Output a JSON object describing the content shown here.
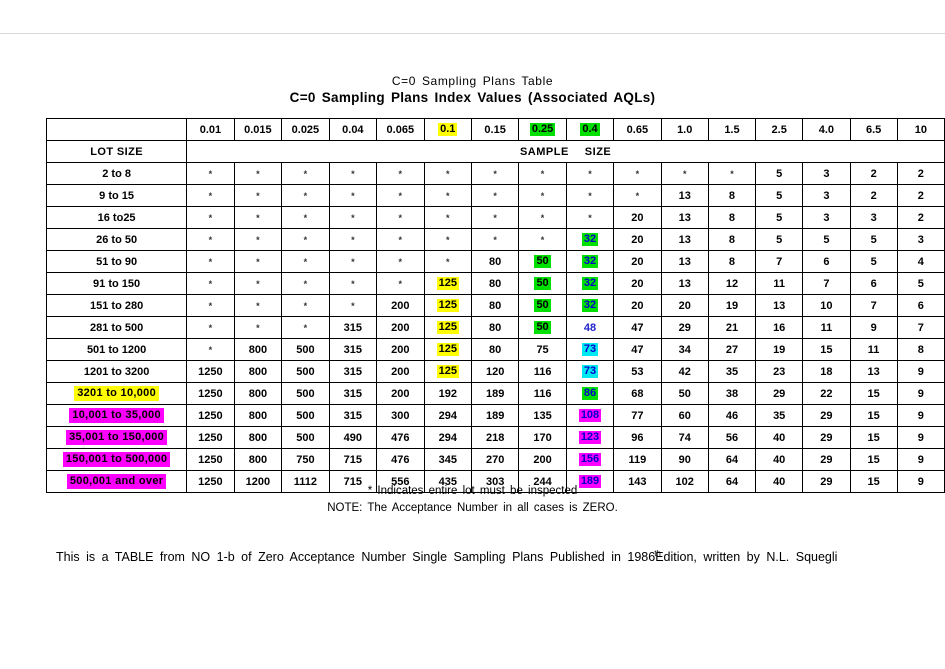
{
  "title": {
    "line1": "C=0  Sampling  Plans  Table",
    "line2": "C=0  Sampling  Plans  Index  Values  (Associated  AQLs)"
  },
  "table": {
    "lot_size_header": "LOT SIZE",
    "sample_size_banner_left": "SAMPLE",
    "sample_size_banner_right": "SIZE",
    "columns": [
      "0.01",
      "0.015",
      "0.025",
      "0.04",
      "0.065",
      "0.1",
      "0.15",
      "0.25",
      "0.4",
      "0.65",
      "1.0",
      "1.5",
      "2.5",
      "4.0",
      "6.5",
      "10"
    ],
    "column_highlights": [
      "none",
      "none",
      "none",
      "none",
      "none",
      "yellow",
      "none",
      "green",
      "green",
      "none",
      "none",
      "none",
      "none",
      "none",
      "none",
      "none"
    ],
    "asterisk_glyph": "*",
    "rows": [
      {
        "lot": "2 to 8",
        "lot_highlight": "none",
        "values": [
          "*",
          "*",
          "*",
          "*",
          "*",
          "*",
          "*",
          "*",
          "*",
          "*",
          "*",
          "*",
          "5",
          "3",
          "2",
          "2"
        ],
        "highlights": [
          "none",
          "none",
          "none",
          "none",
          "none",
          "none",
          "none",
          "none",
          "none",
          "none",
          "none",
          "none",
          "none",
          "none",
          "none",
          "none"
        ]
      },
      {
        "lot": "9 to 15",
        "lot_highlight": "none",
        "values": [
          "*",
          "*",
          "*",
          "*",
          "*",
          "*",
          "*",
          "*",
          "*",
          "*",
          "13",
          "8",
          "5",
          "3",
          "2",
          "2"
        ],
        "highlights": [
          "none",
          "none",
          "none",
          "none",
          "none",
          "none",
          "none",
          "none",
          "none",
          "none",
          "none",
          "none",
          "none",
          "none",
          "none",
          "none"
        ]
      },
      {
        "lot": "16 to25",
        "lot_highlight": "none",
        "values": [
          "*",
          "*",
          "*",
          "*",
          "*",
          "*",
          "*",
          "*",
          "*",
          "20",
          "13",
          "8",
          "5",
          "3",
          "3",
          "2"
        ],
        "highlights": [
          "none",
          "none",
          "none",
          "none",
          "none",
          "none",
          "none",
          "none",
          "none",
          "none",
          "none",
          "none",
          "none",
          "none",
          "none",
          "none"
        ]
      },
      {
        "lot": "26 to 50",
        "lot_highlight": "none",
        "values": [
          "*",
          "*",
          "*",
          "*",
          "*",
          "*",
          "*",
          "*",
          "32",
          "20",
          "13",
          "8",
          "5",
          "5",
          "5",
          "3"
        ],
        "highlights": [
          "none",
          "none",
          "none",
          "none",
          "none",
          "none",
          "none",
          "none",
          "green",
          "none",
          "none",
          "none",
          "none",
          "none",
          "none",
          "none"
        ]
      },
      {
        "lot": "51 to 90",
        "lot_highlight": "none",
        "values": [
          "*",
          "*",
          "*",
          "*",
          "*",
          "*",
          "80",
          "50",
          "32",
          "20",
          "13",
          "8",
          "7",
          "6",
          "5",
          "4"
        ],
        "highlights": [
          "none",
          "none",
          "none",
          "none",
          "none",
          "none",
          "none",
          "green-k",
          "green",
          "none",
          "none",
          "none",
          "none",
          "none",
          "none",
          "none"
        ]
      },
      {
        "lot": "91 to 150",
        "lot_highlight": "none",
        "values": [
          "*",
          "*",
          "*",
          "*",
          "*",
          "125",
          "80",
          "50",
          "32",
          "20",
          "13",
          "12",
          "11",
          "7",
          "6",
          "5"
        ],
        "highlights": [
          "none",
          "none",
          "none",
          "none",
          "none",
          "yellow",
          "none",
          "green-k",
          "green",
          "none",
          "none",
          "none",
          "none",
          "none",
          "none",
          "none"
        ]
      },
      {
        "lot": "151 to 280",
        "lot_highlight": "none",
        "values": [
          "*",
          "*",
          "*",
          "*",
          "200",
          "125",
          "80",
          "50",
          "32",
          "20",
          "20",
          "19",
          "13",
          "10",
          "7",
          "6"
        ],
        "highlights": [
          "none",
          "none",
          "none",
          "none",
          "none",
          "yellow",
          "none",
          "green-k",
          "green",
          "none",
          "none",
          "none",
          "none",
          "none",
          "none",
          "none"
        ]
      },
      {
        "lot": "281 to 500",
        "lot_highlight": "none",
        "values": [
          "*",
          "*",
          "*",
          "315",
          "200",
          "125",
          "80",
          "50",
          "48",
          "47",
          "29",
          "21",
          "16",
          "11",
          "9",
          "7"
        ],
        "highlights": [
          "none",
          "none",
          "none",
          "none",
          "none",
          "yellow",
          "none",
          "green-k",
          "blue",
          "none",
          "none",
          "none",
          "none",
          "none",
          "none",
          "none"
        ]
      },
      {
        "lot": "501 to 1200",
        "lot_highlight": "none",
        "values": [
          "*",
          "800",
          "500",
          "315",
          "200",
          "125",
          "80",
          "75",
          "73",
          "47",
          "34",
          "27",
          "19",
          "15",
          "11",
          "8"
        ],
        "highlights": [
          "none",
          "none",
          "none",
          "none",
          "none",
          "yellow",
          "none",
          "none",
          "cyan",
          "none",
          "none",
          "none",
          "none",
          "none",
          "none",
          "none"
        ]
      },
      {
        "lot": "1201 to 3200",
        "lot_highlight": "none",
        "values": [
          "1250",
          "800",
          "500",
          "315",
          "200",
          "125",
          "120",
          "116",
          "73",
          "53",
          "42",
          "35",
          "23",
          "18",
          "13",
          "9"
        ],
        "highlights": [
          "none",
          "none",
          "none",
          "none",
          "none",
          "yellow",
          "none",
          "none",
          "cyan",
          "none",
          "none",
          "none",
          "none",
          "none",
          "none",
          "none"
        ]
      },
      {
        "lot": "3201 to 10,000",
        "lot_highlight": "yellow",
        "values": [
          "1250",
          "800",
          "500",
          "315",
          "200",
          "192",
          "189",
          "116",
          "86",
          "68",
          "50",
          "38",
          "29",
          "22",
          "15",
          "9"
        ],
        "highlights": [
          "none",
          "none",
          "none",
          "none",
          "none",
          "none",
          "none",
          "none",
          "green",
          "none",
          "none",
          "none",
          "none",
          "none",
          "none",
          "none"
        ]
      },
      {
        "lot": "10,001 to 35,000",
        "lot_highlight": "magenta",
        "values": [
          "1250",
          "800",
          "500",
          "315",
          "300",
          "294",
          "189",
          "135",
          "108",
          "77",
          "60",
          "46",
          "35",
          "29",
          "15",
          "9"
        ],
        "highlights": [
          "none",
          "none",
          "none",
          "none",
          "none",
          "none",
          "none",
          "none",
          "magenta",
          "none",
          "none",
          "none",
          "none",
          "none",
          "none",
          "none"
        ]
      },
      {
        "lot": "35,001 to 150,000",
        "lot_highlight": "magenta",
        "values": [
          "1250",
          "800",
          "500",
          "490",
          "476",
          "294",
          "218",
          "170",
          "123",
          "96",
          "74",
          "56",
          "40",
          "29",
          "15",
          "9"
        ],
        "highlights": [
          "none",
          "none",
          "none",
          "none",
          "none",
          "none",
          "none",
          "none",
          "magenta",
          "none",
          "none",
          "none",
          "none",
          "none",
          "none",
          "none"
        ]
      },
      {
        "lot": "150,001 to 500,000",
        "lot_highlight": "magenta",
        "values": [
          "1250",
          "800",
          "750",
          "715",
          "476",
          "345",
          "270",
          "200",
          "156",
          "119",
          "90",
          "64",
          "40",
          "29",
          "15",
          "9"
        ],
        "highlights": [
          "none",
          "none",
          "none",
          "none",
          "none",
          "none",
          "none",
          "none",
          "magenta",
          "none",
          "none",
          "none",
          "none",
          "none",
          "none",
          "none"
        ]
      },
      {
        "lot": "500,001 and over",
        "lot_highlight": "magenta",
        "values": [
          "1250",
          "1200",
          "1112",
          "715",
          "556",
          "435",
          "303",
          "244",
          "189",
          "143",
          "102",
          "64",
          "40",
          "29",
          "15",
          "9"
        ],
        "highlights": [
          "none",
          "none",
          "none",
          "none",
          "none",
          "none",
          "none",
          "none",
          "magenta",
          "none",
          "none",
          "none",
          "none",
          "none",
          "none",
          "none"
        ]
      }
    ]
  },
  "notes": {
    "line1": "* Indicates entire lot must be inspected",
    "line2": "NOTE: The Acceptance Number in all cases is ZERO."
  },
  "footer": {
    "part1": "This is a TABLE from NO 1-b of Zero Acceptance Number Single Sampling Plans Published in 1986",
    "superscript": "th",
    "part2": "Edition, written by N.L. Squegli"
  },
  "colors": {
    "yellow": "#ffff00",
    "green": "#00e000",
    "cyan": "#00e8f0",
    "magenta": "#ff00ff",
    "blue_text": "#2222cc",
    "black_text": "#000000"
  }
}
